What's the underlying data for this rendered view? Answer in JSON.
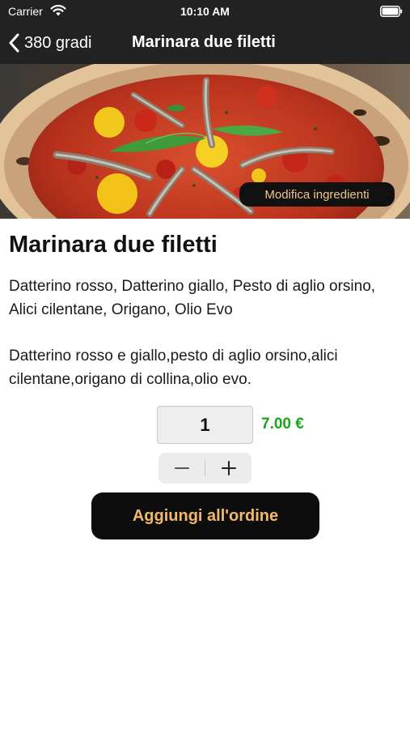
{
  "status_bar": {
    "carrier": "Carrier",
    "time": "10:10 AM",
    "icons": [
      "wifi-icon",
      "battery-icon"
    ]
  },
  "nav": {
    "back_label": "380 gradi",
    "title": "Marinara due filetti"
  },
  "hero": {
    "image_subject": "pizza marinara",
    "edit_button_label": "Modifica ingredienti"
  },
  "product": {
    "name": "Marinara due filetti",
    "ingredients": "Datterino rosso, Datterino giallo, Pesto di aglio orsino, Alici cilentane, Origano, Olio Evo",
    "description": "Datterino rosso e giallo,pesto di aglio orsino,alici cilentane,origano di collina,olio evo.",
    "quantity": "1",
    "price": "7.00 €"
  },
  "actions": {
    "add_to_order_label": "Aggiungi all'ordine",
    "stepper_icons": [
      "minus-icon",
      "plus-icon"
    ]
  },
  "colors": {
    "header_bg": "#222222",
    "price": "#1aa51a",
    "button_bg": "#0d0d0d",
    "button_text": "#f2b96a"
  }
}
